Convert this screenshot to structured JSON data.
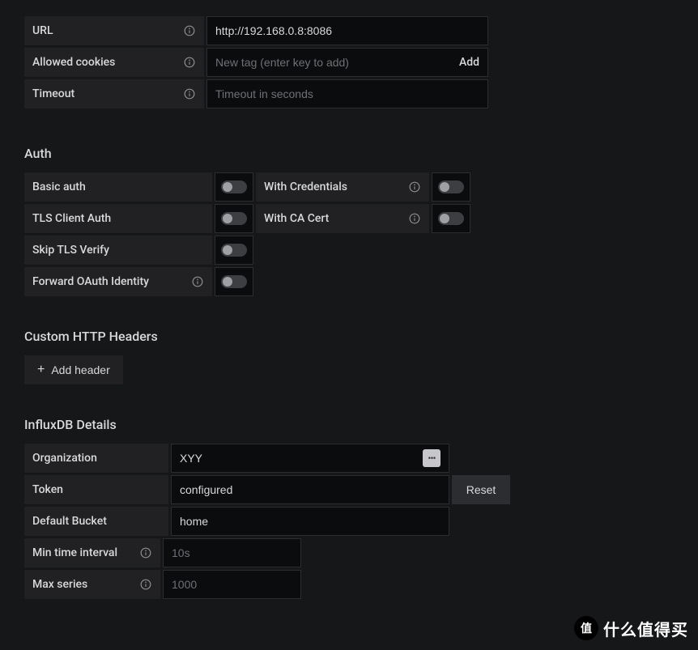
{
  "http": {
    "url_label": "URL",
    "url_value": "http://192.168.0.8:8086",
    "cookies_label": "Allowed cookies",
    "cookies_placeholder": "New tag (enter key to add)",
    "cookies_add": "Add",
    "timeout_label": "Timeout",
    "timeout_placeholder": "Timeout in seconds"
  },
  "auth": {
    "title": "Auth",
    "basic_label": "Basic auth",
    "with_credentials_label": "With Credentials",
    "tls_client_label": "TLS Client Auth",
    "with_cacert_label": "With CA Cert",
    "skip_tls_label": "Skip TLS Verify",
    "forward_oauth_label": "Forward OAuth Identity"
  },
  "headers": {
    "title": "Custom HTTP Headers",
    "add_header_label": "Add header"
  },
  "influx": {
    "title": "InfluxDB Details",
    "org_label": "Organization",
    "org_value": "XYY",
    "token_label": "Token",
    "token_value": "configured",
    "reset_label": "Reset",
    "bucket_label": "Default Bucket",
    "bucket_value": "home",
    "min_interval_label": "Min time interval",
    "min_interval_placeholder": "10s",
    "max_series_label": "Max series",
    "max_series_placeholder": "1000"
  },
  "watermark": {
    "char": "值",
    "text": "什么值得买"
  }
}
